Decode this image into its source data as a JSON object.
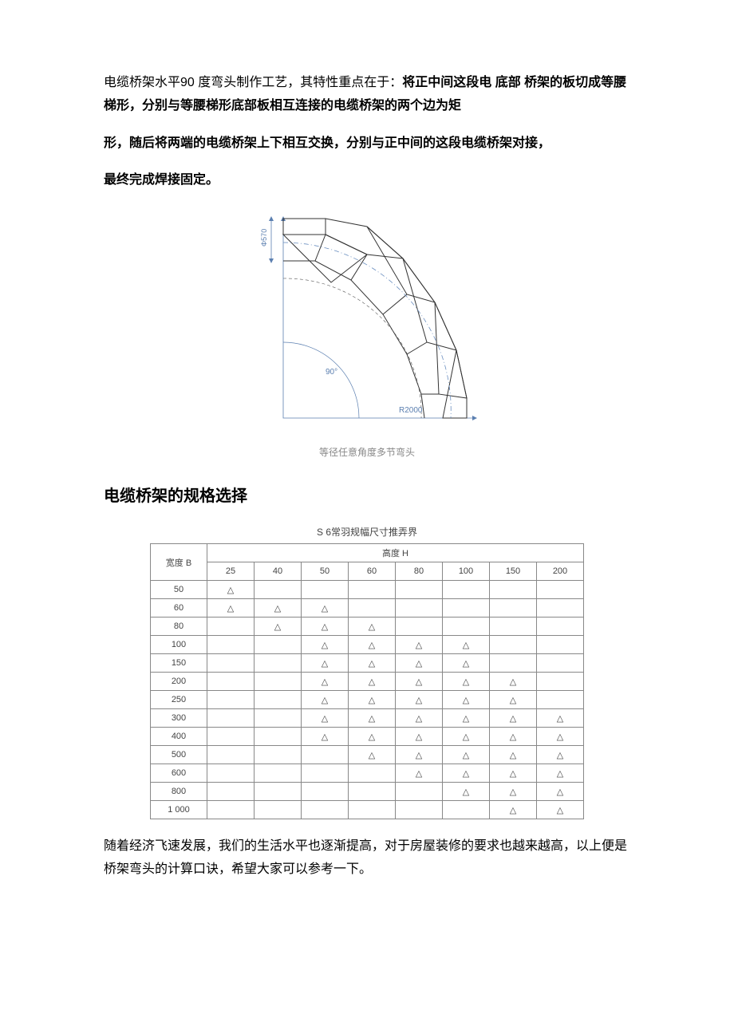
{
  "para1_plain": "电缆桥架水平90 度弯头制作工艺，其特性重点在于：",
  "para1_bold": "将正中间这段电 底部 桥架的板切成等腰梯形，分别与等腰梯形底部板相互连接的电缆桥架的两个边为矩",
  "para2_bold": "形，随后将两端的电缆桥架上下相互交换，分别与正中间的这段电缆桥架对接，",
  "para3_bold": "最终完成焊接固定。",
  "diagram": {
    "dim_label": "Φ570",
    "angle_label": "90°",
    "radius_label": "R2000",
    "caption": "等径任意角度多节弯头"
  },
  "heading2": "电缆桥架的规格选择",
  "table_caption": "S 6常羽规幅尺寸推弄界",
  "table": {
    "row_header": "宽度 B",
    "col_header": "高度 H",
    "heights": [
      "25",
      "40",
      "50",
      "60",
      "80",
      "100",
      "150",
      "200"
    ],
    "widths": [
      "50",
      "60",
      "80",
      "100",
      "150",
      "200",
      "250",
      "300",
      "400",
      "500",
      "600",
      "800",
      "1 000"
    ],
    "mark": "△",
    "cells": [
      [
        1,
        0,
        0,
        0,
        0,
        0,
        0,
        0
      ],
      [
        1,
        1,
        1,
        0,
        0,
        0,
        0,
        0
      ],
      [
        0,
        1,
        1,
        1,
        0,
        0,
        0,
        0
      ],
      [
        0,
        0,
        1,
        1,
        1,
        1,
        0,
        0
      ],
      [
        0,
        0,
        1,
        1,
        1,
        1,
        0,
        0
      ],
      [
        0,
        0,
        1,
        1,
        1,
        1,
        1,
        0
      ],
      [
        0,
        0,
        1,
        1,
        1,
        1,
        1,
        0
      ],
      [
        0,
        0,
        1,
        1,
        1,
        1,
        1,
        1
      ],
      [
        0,
        0,
        1,
        1,
        1,
        1,
        1,
        1
      ],
      [
        0,
        0,
        0,
        1,
        1,
        1,
        1,
        1
      ],
      [
        0,
        0,
        0,
        0,
        1,
        1,
        1,
        1
      ],
      [
        0,
        0,
        0,
        0,
        0,
        1,
        1,
        1
      ],
      [
        0,
        0,
        0,
        0,
        0,
        0,
        1,
        1
      ]
    ]
  },
  "para_last": "随着经济飞速发展，我们的生活水平也逐渐提高，对于房屋装修的要求也越来越高，以上便是桥架弯头的计算口诀，希望大家可以参考一下。"
}
